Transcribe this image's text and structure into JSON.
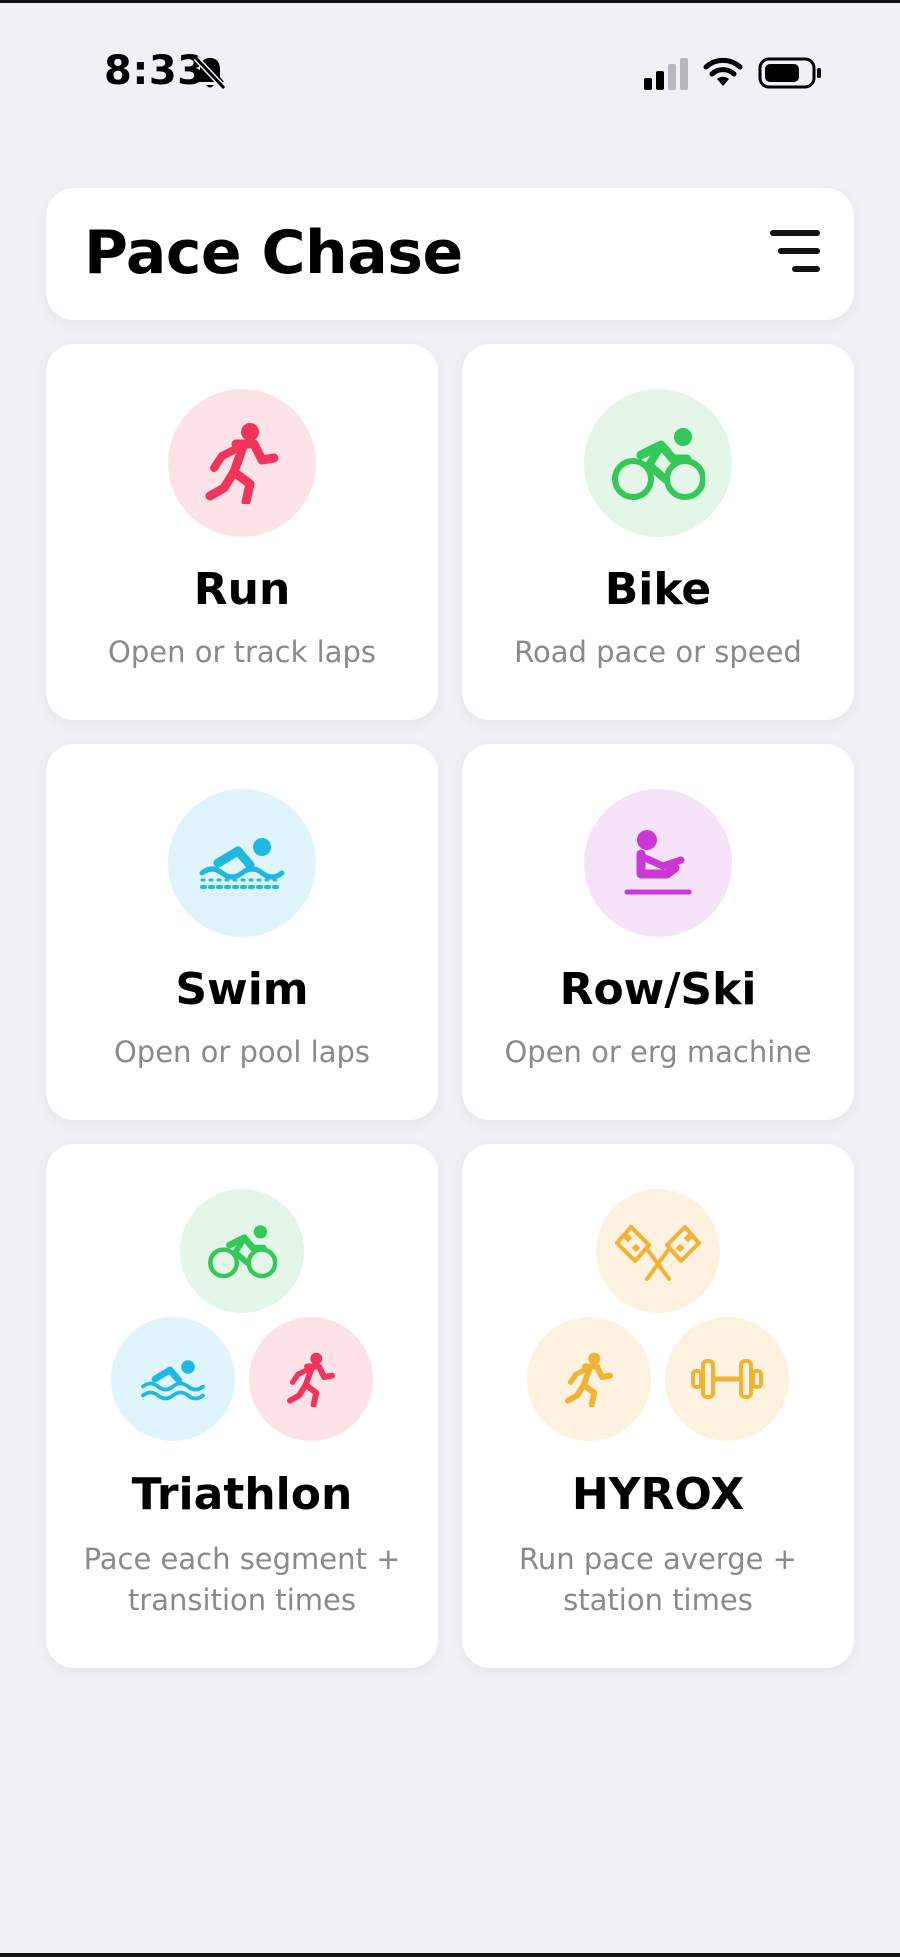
{
  "status_bar": {
    "time": "8:33",
    "icons": [
      "bell-slash-icon",
      "cellular-signal-icon",
      "wifi-icon",
      "battery-icon"
    ]
  },
  "header": {
    "title": "Pace Chase",
    "menu_icon": "filter-menu-icon"
  },
  "cards": [
    {
      "title": "Run",
      "subtitle": "Open or track laps",
      "icon": "running-person-icon",
      "accent": "#f0345c",
      "bg": "#fde3e7"
    },
    {
      "title": "Bike",
      "subtitle": "Road pace or speed",
      "icon": "cyclist-icon",
      "accent": "#34c759",
      "bg": "#e3f6e8"
    },
    {
      "title": "Swim",
      "subtitle": "Open or pool laps",
      "icon": "swimmer-icon",
      "accent": "#1fb8e0",
      "bg": "#dff4fb"
    },
    {
      "title": "Row/Ski",
      "subtitle": "Open or erg machine",
      "icon": "rower-icon",
      "accent": "#cc38d6",
      "bg": "#f6e3f9"
    },
    {
      "title": "Triathlon",
      "subtitle_line1": "Pace each segment +",
      "subtitle_line2": "transition times",
      "icons": [
        "cyclist-icon",
        "swimmer-icon",
        "running-person-icon"
      ]
    },
    {
      "title": "HYROX",
      "subtitle_line1": "Run pace averge +",
      "subtitle_line2": "station times",
      "icons": [
        "checkered-flags-icon",
        "running-person-icon",
        "dumbbell-icon"
      ],
      "accent": "#f2b233",
      "bg": "#fdf2e0"
    }
  ]
}
